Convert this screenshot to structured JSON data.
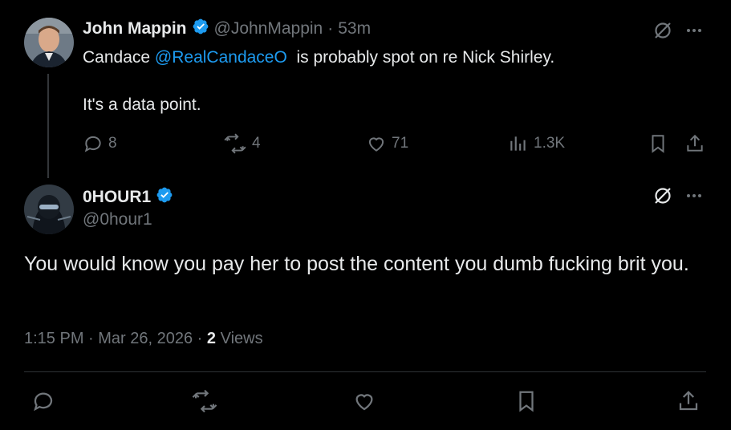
{
  "reply_parent": {
    "author_name": "John Mappin",
    "handle": "@JohnMappin",
    "separator": "·",
    "time": "53m",
    "text_prefix": "Candace ",
    "mention": "@RealCandaceO",
    "text_suffix": "  is probably spot on re Nick Shirley.",
    "text_line2": "It's a data point.",
    "stats": {
      "replies": "8",
      "reposts": "4",
      "likes": "71",
      "views": "1.3K"
    }
  },
  "main_post": {
    "author_name": "0HOUR1",
    "handle": "@0hour1",
    "text": "You would know you pay her to post the content you dumb fucking brit you.",
    "timestamp": "1:15 PM · Mar 26, 2026",
    "meta_separator": "·",
    "views_count": "2",
    "views_label": "Views"
  },
  "colors": {
    "background": "#000000",
    "text": "#e7e9ea",
    "muted": "#71767b",
    "accent": "#1d9bf0"
  }
}
